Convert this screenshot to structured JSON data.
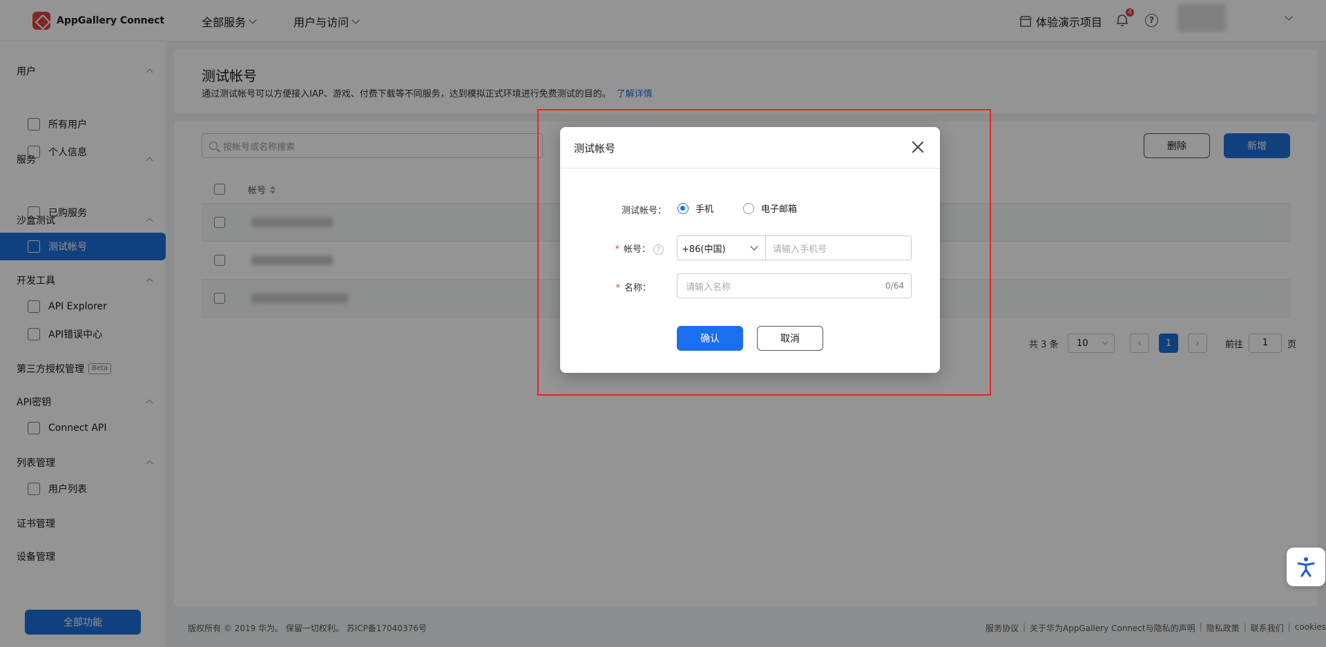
{
  "app": {
    "name": "AppGallery Connect"
  },
  "topbar": {
    "nav": [
      "全部服务",
      "用户与访问"
    ],
    "demo_label": "体验演示项目",
    "notifications": "4"
  },
  "sidebar": {
    "groups": [
      {
        "title": "用户",
        "items": [
          "所有用户",
          "个人信息"
        ]
      },
      {
        "title": "服务",
        "items": [
          "已购服务"
        ]
      },
      {
        "title": "沙盒测试",
        "items": [
          "测试帐号"
        ]
      },
      {
        "title": "开发工具",
        "items": [
          "API Explorer",
          "API错误中心"
        ]
      },
      {
        "title": "第三方授权管理",
        "badge": "Beta"
      },
      {
        "title": "API密钥",
        "items": [
          "Connect API"
        ]
      },
      {
        "title": "列表管理",
        "items": [
          "用户列表"
        ]
      },
      {
        "title": "证书管理"
      },
      {
        "title": "设备管理"
      }
    ],
    "all_functions": "全部功能"
  },
  "page": {
    "title": "测试帐号",
    "description": "通过测试帐号可以方便接入IAP、游戏、付费下载等不同服务，达到模拟正式环境进行免费测试的目的。",
    "learn_more": "了解详情",
    "search_placeholder": "按帐号或名称搜索",
    "delete_label": "删除",
    "add_label": "新增",
    "column_account": "帐号"
  },
  "pagination": {
    "total": "共 3 条",
    "page_size": "10",
    "current": "1",
    "goto_label": "前往",
    "goto_value": "1",
    "page_suffix": "页"
  },
  "footer": {
    "copyright": "版权所有 © 2019 华为。 保留一切权利。 苏ICP备17040376号",
    "links": [
      "服务协议",
      "关于华为AppGallery Connect与隐私的声明",
      "隐私政策",
      "联系我们",
      "cookies"
    ]
  },
  "modal": {
    "title": "测试帐号",
    "type_label": "测试帐号：",
    "type_options": [
      "手机",
      "电子邮箱"
    ],
    "selected_type": "手机",
    "account_label": "帐号：",
    "country_code": "+86(中国)",
    "phone_placeholder": "请输入手机号",
    "name_label": "名称：",
    "name_placeholder": "请输入名称",
    "name_counter": "0/64",
    "confirm_label": "确认",
    "cancel_label": "取消"
  },
  "colors": {
    "primary": "#1e6fd9",
    "danger": "#e0413e",
    "highlight": "#e32525"
  }
}
